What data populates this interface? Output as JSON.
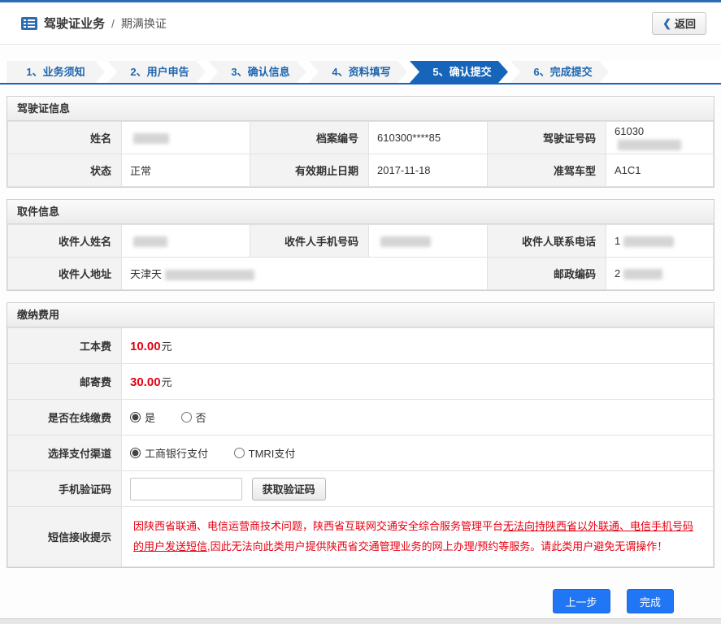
{
  "header": {
    "title_main": "驾驶证业务",
    "title_sep": "/",
    "title_sub": "期满换证",
    "back_label": "返回"
  },
  "steps": [
    {
      "label": "1、业务须知"
    },
    {
      "label": "2、用户申告"
    },
    {
      "label": "3、确认信息"
    },
    {
      "label": "4、资料填写"
    },
    {
      "label": "5、确认提交"
    },
    {
      "label": "6、完成提交"
    }
  ],
  "active_step_index": 4,
  "license": {
    "title": "驾驶证信息",
    "rows": [
      {
        "c1l": "姓名",
        "c1v": "",
        "c2l": "档案编号",
        "c2v": "610300****85",
        "c3l": "驾驶证号码",
        "c3v": "61030"
      },
      {
        "c1l": "状态",
        "c1v": "正常",
        "c2l": "有效期止日期",
        "c2v": "2017-11-18",
        "c3l": "准驾车型",
        "c3v": "A1C1"
      }
    ]
  },
  "pickup": {
    "title": "取件信息",
    "rows": [
      {
        "c1l": "收件人姓名",
        "c1v": "",
        "c2l": "收件人手机号码",
        "c2v": "",
        "c3l": "收件人联系电话",
        "c3v": "1"
      },
      {
        "c1l": "收件人地址",
        "c1v": "天津天",
        "c2l": "邮政编码",
        "c2v": "2"
      }
    ]
  },
  "fees": {
    "title": "缴纳费用",
    "gongben": {
      "label": "工本费",
      "amount": "10.00",
      "unit": "元"
    },
    "youji": {
      "label": "邮寄费",
      "amount": "30.00",
      "unit": "元"
    },
    "online": {
      "label": "是否在线缴费",
      "options": [
        "是",
        "否"
      ],
      "selected": "是"
    },
    "channel": {
      "label": "选择支付渠道",
      "options": [
        "工商银行支付",
        "TMRI支付"
      ],
      "selected": "工商银行支付"
    },
    "captcha": {
      "label": "手机验证码",
      "input_value": "",
      "button": "获取验证码"
    },
    "notice": {
      "label": "短信接收提示",
      "text_before": "因陕西省联通、电信运营商技术问题，陕西省互联网交通安全综合服务管理平台",
      "text_underline": "无法向持陕西省以外联通、电信手机号码的用户发送短信",
      "text_after": ",因此无法向此类用户提供陕西省交通管理业务的网上办理/预约等服务。请此类用户避免无谓操作！"
    }
  },
  "actions": {
    "prev": "上一步",
    "finish": "完成"
  },
  "colors": {
    "accent_blue": "#1665bb",
    "button_blue": "#2176f5",
    "alert_red": "#e60012"
  }
}
